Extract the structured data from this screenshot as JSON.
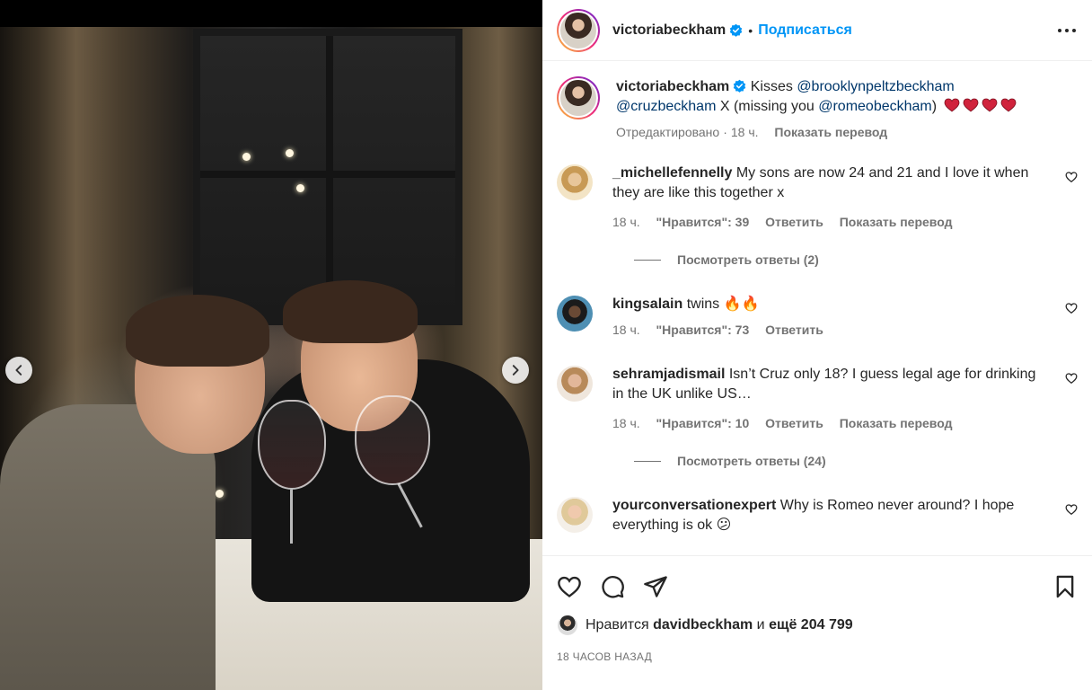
{
  "post": {
    "author": "victoriabeckham",
    "follow_label": "Подписаться",
    "separator": "•",
    "caption": {
      "user": "victoriabeckham",
      "text_1": "Kisses",
      "mention_1": "@brooklynpeltzbeckham",
      "mention_2": "@cruzbeckham",
      "text_2": "X (missing you",
      "mention_3": "@romeobeckham",
      "text_3": ")",
      "edited": "Отредактировано",
      "dot": "·",
      "time": "18 ч.",
      "translate": "Показать перевод"
    }
  },
  "comments": [
    {
      "user": "_michellefennelly",
      "text": "My sons are now 24 and 21 and I love it when they are like this together x",
      "time": "18 ч.",
      "likes": "\"Нравится\": 39",
      "reply": "Ответить",
      "translate": "Показать перевод",
      "view_replies": "Посмотреть ответы (2)"
    },
    {
      "user": "kingsalain",
      "text": "twins 🔥🔥",
      "time": "18 ч.",
      "likes": "\"Нравится\": 73",
      "reply": "Ответить"
    },
    {
      "user": "sehramjadismail",
      "text": "Isn’t Cruz only 18? I guess legal age for drinking in the UK unlike US…",
      "time": "18 ч.",
      "likes": "\"Нравится\": 10",
      "reply": "Ответить",
      "translate": "Показать перевод",
      "view_replies": "Посмотреть ответы (24)"
    },
    {
      "user": "yourconversationexpert",
      "text": "Why is Romeo never around? I hope everything is ok 😕"
    }
  ],
  "likes_bar": {
    "prefix": "Нравится",
    "user": "davidbeckham",
    "middle": "и",
    "count": "ещё 204 799"
  },
  "time_ago": "18 ЧАСОВ НАЗАД",
  "colors": {
    "accent": "#0095f6",
    "mention": "#00376b",
    "heart": "#e0245e",
    "verified": "#0095f6"
  },
  "icons": [
    "chevron-left-icon",
    "chevron-right-icon",
    "verified-badge-icon",
    "more-icon",
    "heart-icon",
    "comment-icon",
    "share-icon",
    "bookmark-icon"
  ]
}
